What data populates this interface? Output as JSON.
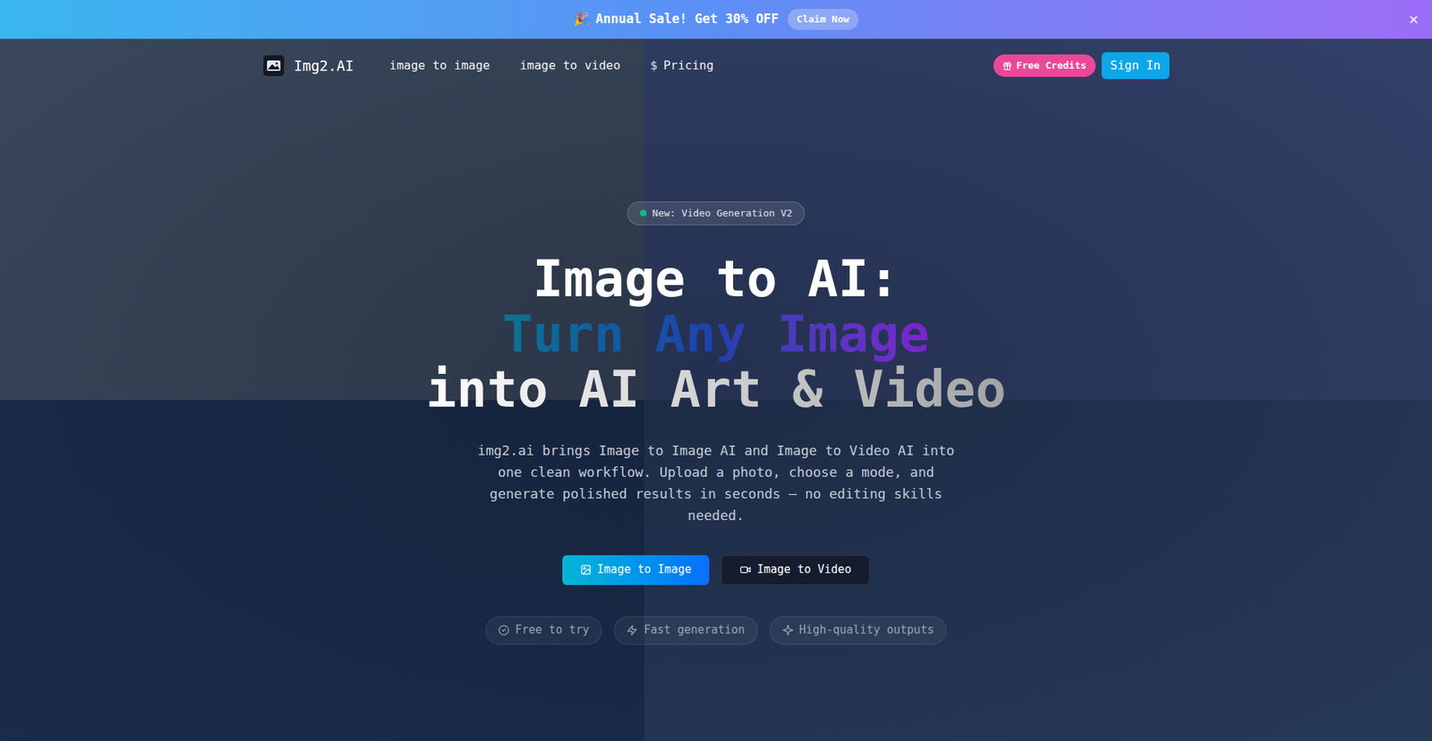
{
  "banner": {
    "icon": "🎉",
    "text": "Annual Sale! Get 30% OFF",
    "button": "Claim Now",
    "close": "×"
  },
  "nav": {
    "logo": "Img2.AI",
    "links": [
      {
        "label": "image to image",
        "icon": ""
      },
      {
        "label": "image to video",
        "icon": ""
      },
      {
        "label": "Pricing",
        "icon": "$"
      }
    ],
    "free_credits": "Free Credits",
    "sign_in": "Sign In"
  },
  "hero": {
    "badge": "New: Video Generation V2",
    "title": [
      "Image to AI:",
      "Turn Any Image",
      "into AI Art & Video"
    ],
    "description": "img2.ai brings Image to Image AI and Image to Video AI into one clean workflow. Upload a photo, choose a mode, and generate polished results in seconds — no editing skills needed.",
    "buttons": [
      {
        "label": "Image to Image",
        "kind": "primary"
      },
      {
        "label": "Image to Video",
        "kind": "secondary"
      }
    ],
    "features": [
      "Free to try",
      "Fast generation",
      "High-quality outputs"
    ]
  }
}
